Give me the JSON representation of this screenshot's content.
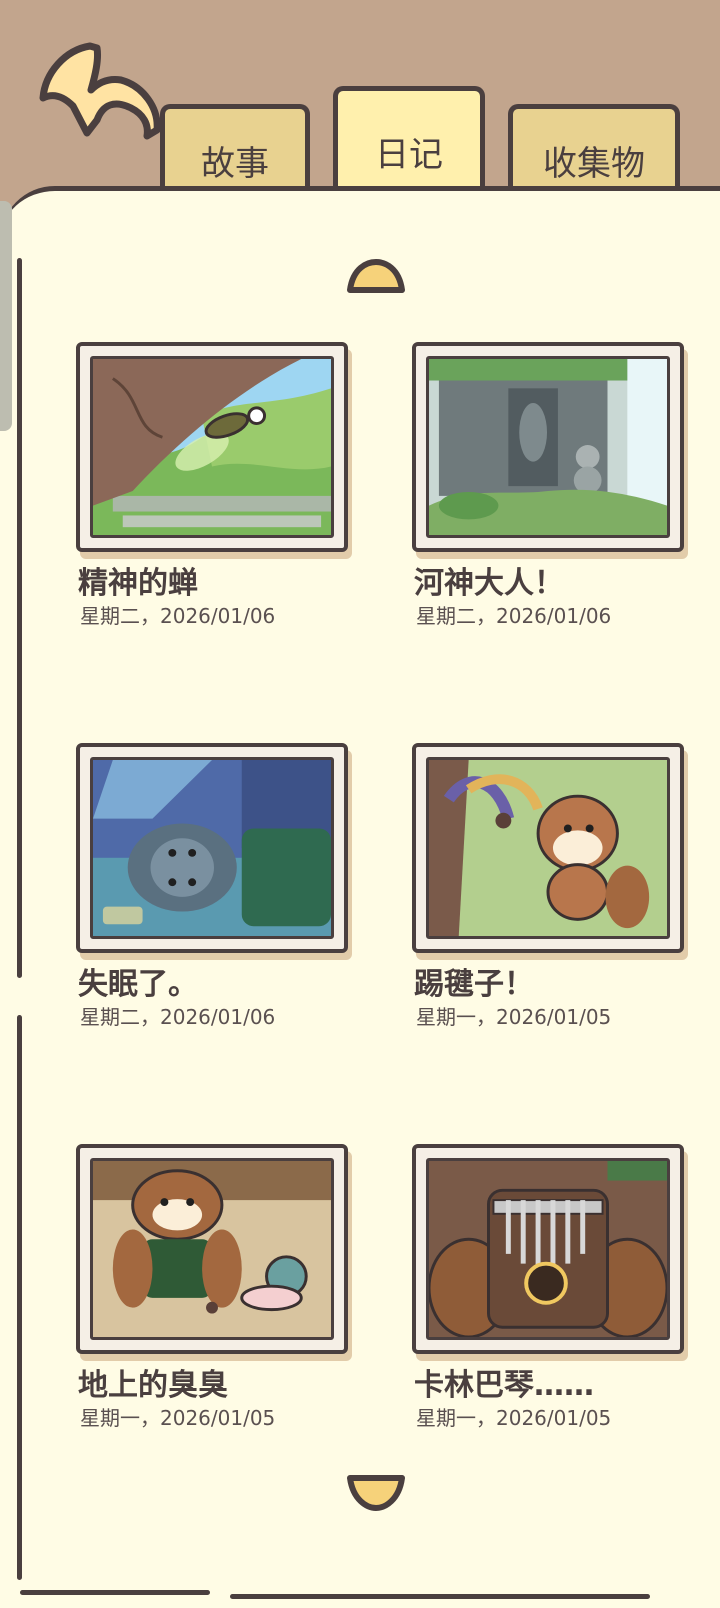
{
  "header": {
    "back_icon": "curved-back-arrow-icon",
    "tabs": [
      {
        "label": "故事",
        "active": false
      },
      {
        "label": "日记",
        "active": true
      },
      {
        "label": "收集物",
        "active": false
      }
    ]
  },
  "diary": {
    "entries": [
      {
        "title": "精神的蝉",
        "date": "星期二，2026/01/06",
        "image": "cicada-on-tree"
      },
      {
        "title": "河神大人！",
        "date": "星期二，2026/01/06",
        "image": "river-god-shrine"
      },
      {
        "title": "失眠了。",
        "date": "星期二，2026/01/06",
        "image": "sleepless-animal-in-bed"
      },
      {
        "title": "踢毽子！",
        "date": "星期一，2026/01/05",
        "image": "squirrel-kicking-shuttlecock"
      },
      {
        "title": "地上的臭臭",
        "date": "星期一，2026/01/05",
        "image": "squirrel-and-snail"
      },
      {
        "title": "卡林巴琴……",
        "date": "星期一，2026/01/05",
        "image": "kalimba-in-paws"
      }
    ]
  },
  "colors": {
    "background": "#c2a58d",
    "page": "#fffce5",
    "tab": "#e8d290",
    "tab_active": "#fff0ad",
    "outline": "#4a3f3f",
    "arrow": "#f6d27a"
  }
}
